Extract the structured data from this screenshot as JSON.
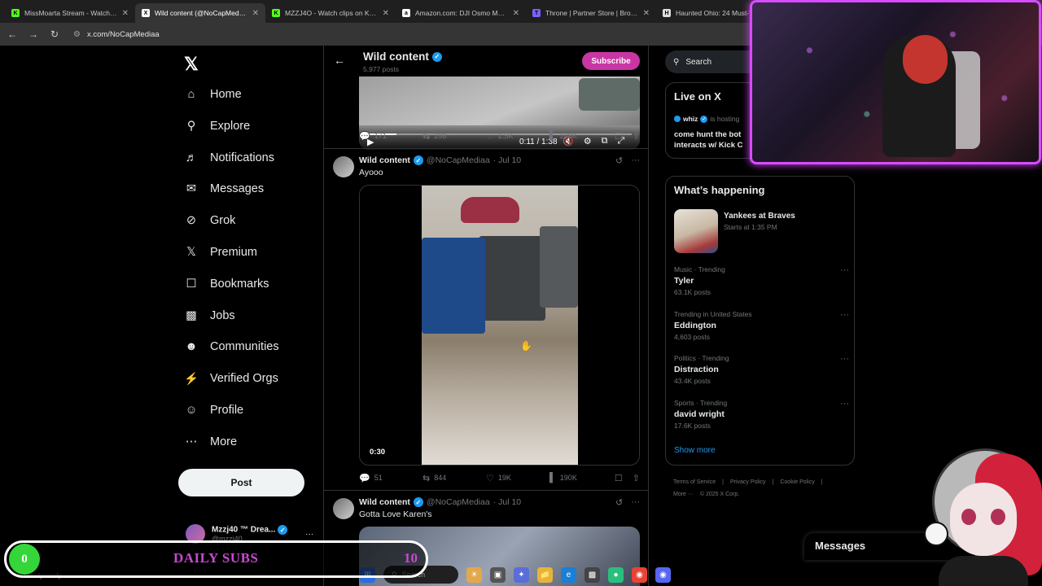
{
  "browser": {
    "tabs": [
      {
        "title": "MissMoarta Stream - Watch Li...",
        "fav": "K",
        "fav_color": "#53fc18",
        "active": false
      },
      {
        "title": "Wild content (@NoCapMediaa)...",
        "fav": "X",
        "fav_color": "#ffffff",
        "active": true
      },
      {
        "title": "MZZJ4O - Watch clips on Kick",
        "fav": "K",
        "fav_color": "#53fc18",
        "active": false
      },
      {
        "title": "Amazon.com: DJI Osmo Mobile...",
        "fav": "a",
        "fav_color": "#ffffff",
        "active": false
      },
      {
        "title": "Throne | Partner Store | Browse...",
        "fav": "T",
        "fav_color": "#7b61ff",
        "active": false
      },
      {
        "title": "Haunted Ohio: 24 Must-Visit...",
        "fav": "H",
        "fav_color": "#dddddd",
        "active": false
      }
    ],
    "url": "x.com/NoCapMediaa"
  },
  "nav": {
    "items": [
      {
        "label": "Home",
        "icon": "home-icon"
      },
      {
        "label": "Explore",
        "icon": "search-icon"
      },
      {
        "label": "Notifications",
        "icon": "bell-icon"
      },
      {
        "label": "Messages",
        "icon": "mail-icon"
      },
      {
        "label": "Grok",
        "icon": "grok-icon"
      },
      {
        "label": "Premium",
        "icon": "x-logo-icon"
      },
      {
        "label": "Bookmarks",
        "icon": "bookmark-icon"
      },
      {
        "label": "Jobs",
        "icon": "briefcase-icon"
      },
      {
        "label": "Communities",
        "icon": "people-icon"
      },
      {
        "label": "Verified Orgs",
        "icon": "lightning-icon"
      },
      {
        "label": "Profile",
        "icon": "person-icon"
      },
      {
        "label": "More",
        "icon": "more-circle-icon"
      }
    ],
    "post_label": "Post",
    "account": {
      "name": "Mzzj40 ™ Drea...",
      "handle": "@mzzj40"
    }
  },
  "profile_header": {
    "title": "Wild content",
    "post_count": "5,977 posts",
    "subscribe_label": "Subscribe"
  },
  "tweets": [
    {
      "video_time": "0:11 / 1:38",
      "video_progress": 0.11,
      "replies": "171",
      "reposts": "298",
      "likes": "2.5K",
      "views": "248K"
    },
    {
      "name": "Wild content",
      "handle": "@NoCapMediaa",
      "date": "· Jul 10",
      "text": "Ayooo",
      "video_time": "0:30",
      "replies": "51",
      "reposts": "844",
      "likes": "19K",
      "views": "190K"
    },
    {
      "name": "Wild content",
      "handle": "@NoCapMediaa",
      "date": "· Jul 10",
      "text": "Gotta Love Karen's"
    }
  ],
  "right": {
    "search_placeholder": "Search",
    "live": {
      "title": "Live on X",
      "host": "whiz",
      "host_status": "is hosting",
      "desc_line1": "come hunt the bot",
      "desc_line2": "interacts w/ Kick C"
    },
    "happening": {
      "title": "What’s happening",
      "event": {
        "title": "Yankees at Braves",
        "sub": "Starts at 1:35 PM"
      },
      "trends": [
        {
          "category": "Music · Trending",
          "name": "Tyler",
          "count": "63.1K posts"
        },
        {
          "category": "Trending in United States",
          "name": "Eddington",
          "count": "4,603 posts"
        },
        {
          "category": "Politics · Trending",
          "name": "Distraction",
          "count": "43.4K posts"
        },
        {
          "category": "Sports · Trending",
          "name": "david wright",
          "count": "17.6K posts"
        }
      ],
      "show_more": "Show more"
    },
    "footer": {
      "links": [
        "Terms of Service",
        "|",
        "Privacy Policy",
        "|",
        "Cookie Policy",
        "|"
      ],
      "more": "More ···",
      "copyright": "© 2025 X Corp."
    },
    "messages_label": "Messages"
  },
  "overlay": {
    "subs_count": "0",
    "subs_label": "DAILY SUBS",
    "subs_goal": "10",
    "subs_progress": 0,
    "status_text": "Ready ready",
    "taskbar_search": "Search"
  },
  "colors": {
    "accent": "#1d9bf0",
    "subscribe": "#c936a4",
    "webcam_border": "#d94bff",
    "subs_green": "#35d63a",
    "subs_text": "#c64ad1"
  }
}
